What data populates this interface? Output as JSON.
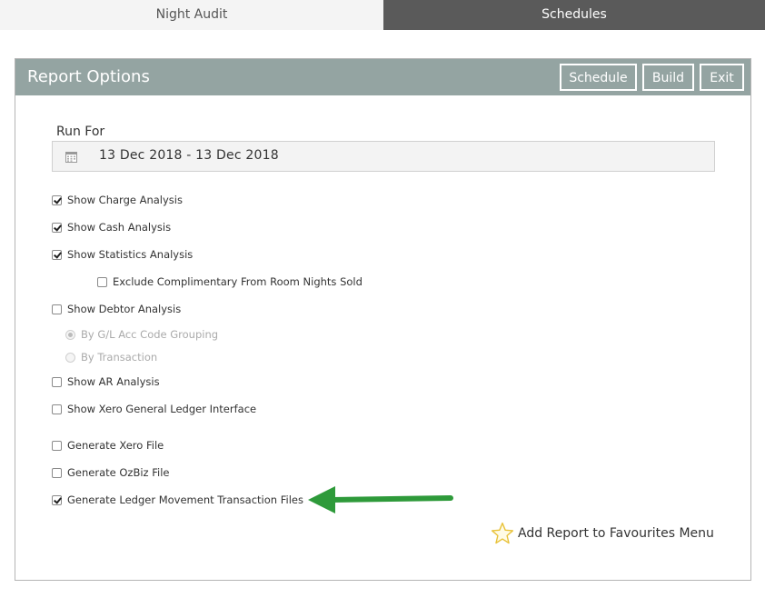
{
  "tabs": [
    {
      "label": "Night Audit",
      "active": true
    },
    {
      "label": "Schedules",
      "active": false
    }
  ],
  "panel": {
    "title": "Report Options",
    "buttons": {
      "schedule": "Schedule",
      "build": "Build",
      "exit": "Exit"
    }
  },
  "run_for": {
    "label": "Run For",
    "value": "13 Dec 2018 - 13 Dec 2018",
    "icon": "calendar-icon"
  },
  "options": {
    "charge_analysis": {
      "label": "Show Charge Analysis",
      "checked": true
    },
    "cash_analysis": {
      "label": "Show Cash Analysis",
      "checked": true
    },
    "statistics_analysis": {
      "label": "Show Statistics Analysis",
      "checked": true
    },
    "exclude_complimentary": {
      "label": "Exclude Complimentary From Room Nights Sold",
      "checked": false
    },
    "debtor_analysis": {
      "label": "Show Debtor Analysis",
      "checked": false
    },
    "by_gl_acc_code": {
      "label": "By G/L Acc Code Grouping",
      "selected": true,
      "disabled": true
    },
    "by_transaction": {
      "label": "By Transaction",
      "selected": false,
      "disabled": true
    },
    "ar_analysis": {
      "label": "Show AR Analysis",
      "checked": false
    },
    "xero_gl_interface": {
      "label": "Show Xero General Ledger Interface",
      "checked": false
    },
    "generate_xero": {
      "label": "Generate Xero File",
      "checked": false
    },
    "generate_ozbiz": {
      "label": "Generate OzBiz File",
      "checked": false
    },
    "generate_ledger_movement": {
      "label": "Generate Ledger Movement Transaction Files",
      "checked": true
    }
  },
  "favourites": {
    "label": "Add Report to Favourites Menu",
    "icon": "star-icon"
  },
  "colors": {
    "header_bg": "#94a4a2",
    "inactive_tab_bg": "#5a5a5a",
    "arrow": "#2e9a3a",
    "star": "#e8c23a"
  }
}
